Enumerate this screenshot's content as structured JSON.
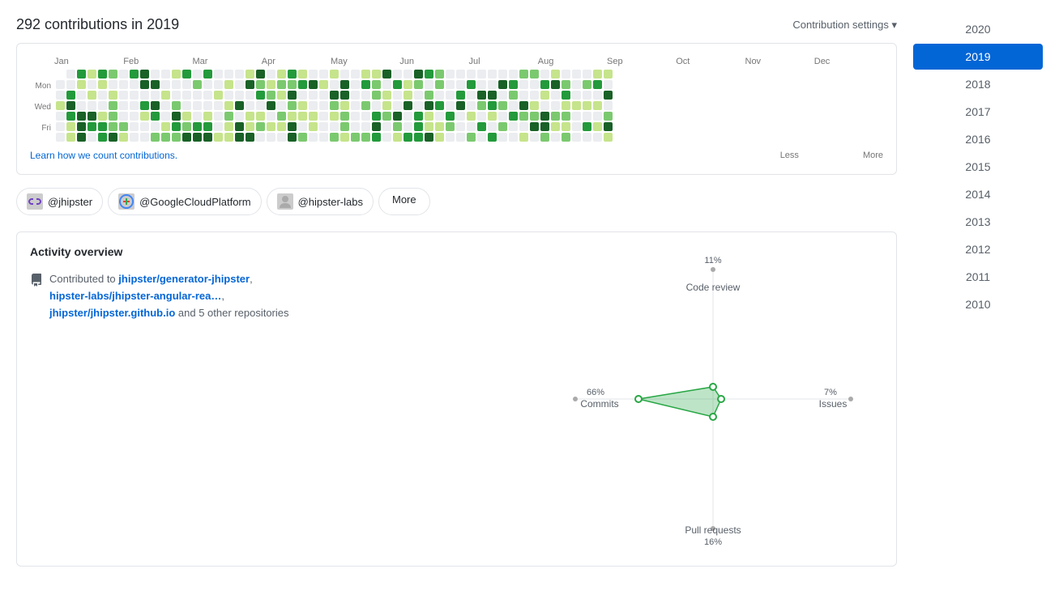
{
  "header": {
    "title": "292 contributions in 2019",
    "settings_label": "Contribution settings ▾"
  },
  "calendar": {
    "months": [
      "Jan",
      "Feb",
      "Mar",
      "Apr",
      "May",
      "Jun",
      "Jul",
      "Aug",
      "Sep",
      "Oct",
      "Nov",
      "Dec"
    ],
    "day_labels": [
      "",
      "Mon",
      "",
      "Wed",
      "",
      "Fri",
      ""
    ],
    "learn_link": "Learn how we count contributions.",
    "legend": {
      "less": "Less",
      "more": "More"
    }
  },
  "org_tabs": [
    {
      "id": "jhipster",
      "label": "@jhipster",
      "icon_type": "bow-tie"
    },
    {
      "id": "googlecloud",
      "label": "@GoogleCloudPlatform",
      "icon_type": "gcp"
    },
    {
      "id": "hipster-labs",
      "label": "@hipster-labs",
      "icon_type": "avatar"
    }
  ],
  "more_button": "More",
  "activity": {
    "title": "Activity overview",
    "description_pre": "Contributed to ",
    "repos": [
      {
        "label": "jhipster/generator-jhipster",
        "url": "#"
      },
      {
        "label": "hipster-labs/jhipster-angular-rea…",
        "url": "#"
      },
      {
        "label": "jhipster/jhipster.github.io",
        "url": "#"
      }
    ],
    "description_post": " and 5 other repositories"
  },
  "radar": {
    "code_review": {
      "label": "Code review",
      "percent": "11%"
    },
    "commits": {
      "label": "Commits",
      "percent": "66%"
    },
    "issues": {
      "label": "Issues",
      "percent": "7%"
    },
    "pull_requests": {
      "label": "Pull requests",
      "percent": "16%"
    }
  },
  "sidebar": {
    "years": [
      {
        "year": "2020",
        "active": false
      },
      {
        "year": "2019",
        "active": true
      },
      {
        "year": "2018",
        "active": false
      },
      {
        "year": "2017",
        "active": false
      },
      {
        "year": "2016",
        "active": false
      },
      {
        "year": "2015",
        "active": false
      },
      {
        "year": "2014",
        "active": false
      },
      {
        "year": "2013",
        "active": false
      },
      {
        "year": "2012",
        "active": false
      },
      {
        "year": "2011",
        "active": false
      },
      {
        "year": "2010",
        "active": false
      }
    ]
  }
}
